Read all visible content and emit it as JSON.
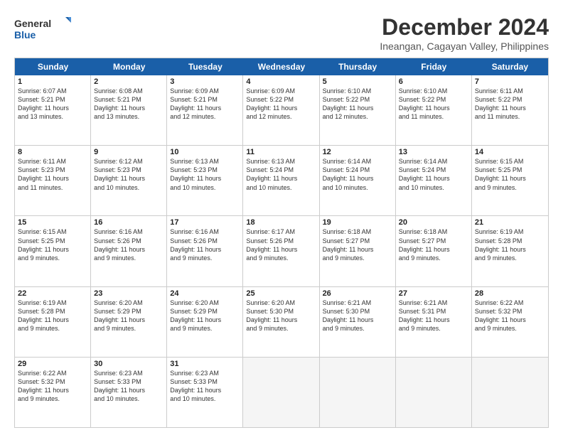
{
  "logo": {
    "line1": "General",
    "line2": "Blue"
  },
  "title": "December 2024",
  "location": "Ineangan, Cagayan Valley, Philippines",
  "header_days": [
    "Sunday",
    "Monday",
    "Tuesday",
    "Wednesday",
    "Thursday",
    "Friday",
    "Saturday"
  ],
  "weeks": [
    [
      {
        "day": "1",
        "lines": [
          "Sunrise: 6:07 AM",
          "Sunset: 5:21 PM",
          "Daylight: 11 hours",
          "and 13 minutes."
        ]
      },
      {
        "day": "2",
        "lines": [
          "Sunrise: 6:08 AM",
          "Sunset: 5:21 PM",
          "Daylight: 11 hours",
          "and 13 minutes."
        ]
      },
      {
        "day": "3",
        "lines": [
          "Sunrise: 6:09 AM",
          "Sunset: 5:21 PM",
          "Daylight: 11 hours",
          "and 12 minutes."
        ]
      },
      {
        "day": "4",
        "lines": [
          "Sunrise: 6:09 AM",
          "Sunset: 5:22 PM",
          "Daylight: 11 hours",
          "and 12 minutes."
        ]
      },
      {
        "day": "5",
        "lines": [
          "Sunrise: 6:10 AM",
          "Sunset: 5:22 PM",
          "Daylight: 11 hours",
          "and 12 minutes."
        ]
      },
      {
        "day": "6",
        "lines": [
          "Sunrise: 6:10 AM",
          "Sunset: 5:22 PM",
          "Daylight: 11 hours",
          "and 11 minutes."
        ]
      },
      {
        "day": "7",
        "lines": [
          "Sunrise: 6:11 AM",
          "Sunset: 5:22 PM",
          "Daylight: 11 hours",
          "and 11 minutes."
        ]
      }
    ],
    [
      {
        "day": "8",
        "lines": [
          "Sunrise: 6:11 AM",
          "Sunset: 5:23 PM",
          "Daylight: 11 hours",
          "and 11 minutes."
        ]
      },
      {
        "day": "9",
        "lines": [
          "Sunrise: 6:12 AM",
          "Sunset: 5:23 PM",
          "Daylight: 11 hours",
          "and 10 minutes."
        ]
      },
      {
        "day": "10",
        "lines": [
          "Sunrise: 6:13 AM",
          "Sunset: 5:23 PM",
          "Daylight: 11 hours",
          "and 10 minutes."
        ]
      },
      {
        "day": "11",
        "lines": [
          "Sunrise: 6:13 AM",
          "Sunset: 5:24 PM",
          "Daylight: 11 hours",
          "and 10 minutes."
        ]
      },
      {
        "day": "12",
        "lines": [
          "Sunrise: 6:14 AM",
          "Sunset: 5:24 PM",
          "Daylight: 11 hours",
          "and 10 minutes."
        ]
      },
      {
        "day": "13",
        "lines": [
          "Sunrise: 6:14 AM",
          "Sunset: 5:24 PM",
          "Daylight: 11 hours",
          "and 10 minutes."
        ]
      },
      {
        "day": "14",
        "lines": [
          "Sunrise: 6:15 AM",
          "Sunset: 5:25 PM",
          "Daylight: 11 hours",
          "and 9 minutes."
        ]
      }
    ],
    [
      {
        "day": "15",
        "lines": [
          "Sunrise: 6:15 AM",
          "Sunset: 5:25 PM",
          "Daylight: 11 hours",
          "and 9 minutes."
        ]
      },
      {
        "day": "16",
        "lines": [
          "Sunrise: 6:16 AM",
          "Sunset: 5:26 PM",
          "Daylight: 11 hours",
          "and 9 minutes."
        ]
      },
      {
        "day": "17",
        "lines": [
          "Sunrise: 6:16 AM",
          "Sunset: 5:26 PM",
          "Daylight: 11 hours",
          "and 9 minutes."
        ]
      },
      {
        "day": "18",
        "lines": [
          "Sunrise: 6:17 AM",
          "Sunset: 5:26 PM",
          "Daylight: 11 hours",
          "and 9 minutes."
        ]
      },
      {
        "day": "19",
        "lines": [
          "Sunrise: 6:18 AM",
          "Sunset: 5:27 PM",
          "Daylight: 11 hours",
          "and 9 minutes."
        ]
      },
      {
        "day": "20",
        "lines": [
          "Sunrise: 6:18 AM",
          "Sunset: 5:27 PM",
          "Daylight: 11 hours",
          "and 9 minutes."
        ]
      },
      {
        "day": "21",
        "lines": [
          "Sunrise: 6:19 AM",
          "Sunset: 5:28 PM",
          "Daylight: 11 hours",
          "and 9 minutes."
        ]
      }
    ],
    [
      {
        "day": "22",
        "lines": [
          "Sunrise: 6:19 AM",
          "Sunset: 5:28 PM",
          "Daylight: 11 hours",
          "and 9 minutes."
        ]
      },
      {
        "day": "23",
        "lines": [
          "Sunrise: 6:20 AM",
          "Sunset: 5:29 PM",
          "Daylight: 11 hours",
          "and 9 minutes."
        ]
      },
      {
        "day": "24",
        "lines": [
          "Sunrise: 6:20 AM",
          "Sunset: 5:29 PM",
          "Daylight: 11 hours",
          "and 9 minutes."
        ]
      },
      {
        "day": "25",
        "lines": [
          "Sunrise: 6:20 AM",
          "Sunset: 5:30 PM",
          "Daylight: 11 hours",
          "and 9 minutes."
        ]
      },
      {
        "day": "26",
        "lines": [
          "Sunrise: 6:21 AM",
          "Sunset: 5:30 PM",
          "Daylight: 11 hours",
          "and 9 minutes."
        ]
      },
      {
        "day": "27",
        "lines": [
          "Sunrise: 6:21 AM",
          "Sunset: 5:31 PM",
          "Daylight: 11 hours",
          "and 9 minutes."
        ]
      },
      {
        "day": "28",
        "lines": [
          "Sunrise: 6:22 AM",
          "Sunset: 5:32 PM",
          "Daylight: 11 hours",
          "and 9 minutes."
        ]
      }
    ],
    [
      {
        "day": "29",
        "lines": [
          "Sunrise: 6:22 AM",
          "Sunset: 5:32 PM",
          "Daylight: 11 hours",
          "and 9 minutes."
        ]
      },
      {
        "day": "30",
        "lines": [
          "Sunrise: 6:23 AM",
          "Sunset: 5:33 PM",
          "Daylight: 11 hours",
          "and 10 minutes."
        ]
      },
      {
        "day": "31",
        "lines": [
          "Sunrise: 6:23 AM",
          "Sunset: 5:33 PM",
          "Daylight: 11 hours",
          "and 10 minutes."
        ]
      },
      {
        "day": "",
        "lines": []
      },
      {
        "day": "",
        "lines": []
      },
      {
        "day": "",
        "lines": []
      },
      {
        "day": "",
        "lines": []
      }
    ]
  ]
}
